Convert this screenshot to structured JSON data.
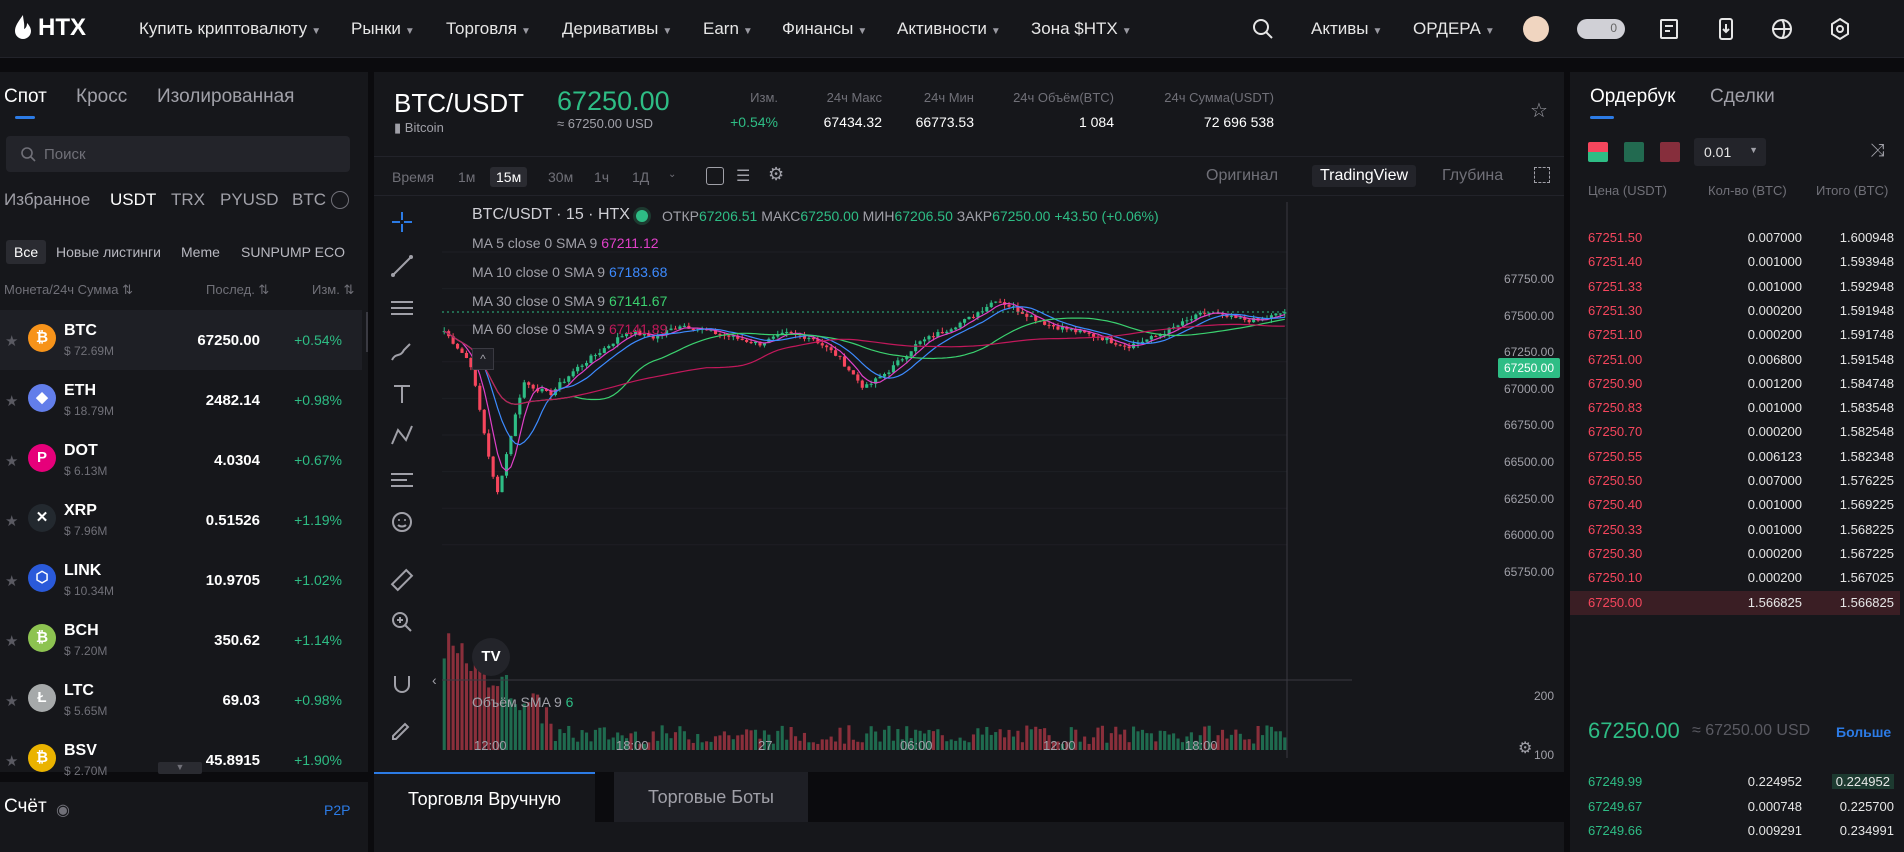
{
  "nav": {
    "logo": "HTX",
    "items": [
      {
        "label": "Купить криптовалюту"
      },
      {
        "label": "Рынки"
      },
      {
        "label": "Торговля"
      },
      {
        "label": "Деривативы"
      },
      {
        "label": "Earn"
      },
      {
        "label": "Финансы"
      },
      {
        "label": "Активности"
      },
      {
        "label": "Зона $HTX"
      }
    ],
    "assets": "Активы",
    "orders": "ОРДЕРА",
    "toggle_value": "0"
  },
  "left": {
    "tabs": [
      "Спот",
      "Кросс",
      "Изолированная"
    ],
    "search_placeholder": "Поиск",
    "quote_tabs": [
      "Избранное",
      "USDT",
      "TRX",
      "PYUSD",
      "BTC"
    ],
    "cat_tabs": [
      "Все",
      "Новые листинги",
      "Meme",
      "SUNPUMP ECO"
    ],
    "col_headers": [
      "Монета/24ч Сумма",
      "Послед.",
      "Изм."
    ],
    "coins": [
      {
        "sym": "BTC",
        "vol": "$ 72.69M",
        "price": "67250.00",
        "chg": "+0.54%",
        "color": "#f7931a",
        "glyph": "₿"
      },
      {
        "sym": "ETH",
        "vol": "$ 18.79M",
        "price": "2482.14",
        "chg": "+0.98%",
        "color": "#627eea",
        "glyph": "◆"
      },
      {
        "sym": "DOT",
        "vol": "$ 6.13M",
        "price": "4.0304",
        "chg": "+0.67%",
        "color": "#e6007a",
        "glyph": "P"
      },
      {
        "sym": "XRP",
        "vol": "$ 7.96M",
        "price": "0.51526",
        "chg": "+1.19%",
        "color": "#23292f",
        "glyph": "✕"
      },
      {
        "sym": "LINK",
        "vol": "$ 10.34M",
        "price": "10.9705",
        "chg": "+1.02%",
        "color": "#2a5ada",
        "glyph": "⬡"
      },
      {
        "sym": "BCH",
        "vol": "$ 7.20M",
        "price": "350.62",
        "chg": "+1.14%",
        "color": "#8dc351",
        "glyph": "₿"
      },
      {
        "sym": "LTC",
        "vol": "$ 5.65M",
        "price": "69.03",
        "chg": "+0.98%",
        "color": "#a6a9aa",
        "glyph": "Ł"
      },
      {
        "sym": "BSV",
        "vol": "$ 2.70M",
        "price": "45.8915",
        "chg": "+1.90%",
        "color": "#eab300",
        "glyph": "₿"
      }
    ],
    "account_title": "Счёт",
    "p2p": "P2P"
  },
  "ticker": {
    "pair": "BTC/USDT",
    "name": "Bitcoin",
    "last": "67250.00",
    "last_usd": "≈ 67250.00 USD",
    "stats": [
      {
        "label": "Изм.",
        "value": "+0.54%"
      },
      {
        "label": "24ч Макс",
        "value": "67434.32"
      },
      {
        "label": "24ч Мин",
        "value": "66773.53"
      },
      {
        "label": "24ч Объём(BTC)",
        "value": "1 084"
      },
      {
        "label": "24ч Сумма(USDT)",
        "value": "72 696 538"
      }
    ]
  },
  "toolbar": {
    "timeframes": [
      "Время",
      "1м",
      "15м",
      "30м",
      "1ч",
      "1Д"
    ],
    "views": [
      "Оригинал",
      "TradingView",
      "Глубина"
    ]
  },
  "chart": {
    "legend_title": "BTC/USDT · 15 · HTX",
    "ohlc": {
      "o_label": "ОТКР",
      "o": "67206.51",
      "h_label": "МАКС",
      "h": "67250.00",
      "l_label": "МИН",
      "l": "67206.50",
      "c_label": "ЗАКР",
      "c": "67250.00",
      "chg": "+43.50 (+0.06%)"
    },
    "ma": [
      {
        "label": "MA 5 close 0 SMA 9",
        "value": "67211.12",
        "color": "#e040c8"
      },
      {
        "label": "MA 10 close 0 SMA 9",
        "value": "67183.68",
        "color": "#3d8bff"
      },
      {
        "label": "MA 30 close 0 SMA 9",
        "value": "67141.67",
        "color": "#3bd16f"
      },
      {
        "label": "MA 60 close 0 SMA 9",
        "value": "67141.89",
        "color": "#c2185b"
      }
    ],
    "y_ticks": [
      "67750.00",
      "67500.00",
      "67250.00",
      "67000.00",
      "66750.00",
      "66500.00",
      "66250.00",
      "66000.00",
      "65750.00"
    ],
    "current_price": "67250.00",
    "volume_label": "Объём SMA 9",
    "volume_value": "6",
    "vol_ticks": [
      "200",
      "100"
    ],
    "vol_current": "6",
    "x_ticks": [
      "12:00",
      "18:00",
      "27",
      "06:00",
      "12:00",
      "18:00"
    ]
  },
  "chart_data": {
    "type": "candlestick",
    "title": "BTC/USDT · 15 · HTX",
    "y_range": [
      65600,
      67800
    ],
    "x_ticks": [
      "12:00",
      "18:00",
      "27",
      "06:00",
      "12:00",
      "18:00"
    ],
    "approx_close_path": [
      67100,
      66850,
      65800,
      66700,
      66600,
      66800,
      66950,
      67100,
      67050,
      67150,
      67100,
      67050,
      67000,
      67080,
      67050,
      66900,
      66650,
      66800,
      67000,
      67100,
      67200,
      67350,
      67250,
      67150,
      67100,
      67050,
      66980,
      67050,
      67150,
      67250,
      67200,
      67180,
      67250
    ]
  },
  "trade_tabs": [
    "Торговля Вручную",
    "Торговые Боты"
  ],
  "orderbook": {
    "tabs": [
      "Ордербук",
      "Сделки"
    ],
    "precision": "0.01",
    "headers": [
      "Цена (USDT)",
      "Кол-во (BTC)",
      "Итого (BTC)"
    ],
    "asks": [
      {
        "p": "67251.50",
        "q": "0.007000",
        "t": "1.600948"
      },
      {
        "p": "67251.40",
        "q": "0.001000",
        "t": "1.593948"
      },
      {
        "p": "67251.33",
        "q": "0.001000",
        "t": "1.592948"
      },
      {
        "p": "67251.30",
        "q": "0.000200",
        "t": "1.591948"
      },
      {
        "p": "67251.10",
        "q": "0.000200",
        "t": "1.591748"
      },
      {
        "p": "67251.00",
        "q": "0.006800",
        "t": "1.591548"
      },
      {
        "p": "67250.90",
        "q": "0.001200",
        "t": "1.584748"
      },
      {
        "p": "67250.83",
        "q": "0.001000",
        "t": "1.583548"
      },
      {
        "p": "67250.70",
        "q": "0.000200",
        "t": "1.582548"
      },
      {
        "p": "67250.55",
        "q": "0.006123",
        "t": "1.582348"
      },
      {
        "p": "67250.50",
        "q": "0.007000",
        "t": "1.576225"
      },
      {
        "p": "67250.40",
        "q": "0.001000",
        "t": "1.569225"
      },
      {
        "p": "67250.33",
        "q": "0.001000",
        "t": "1.568225"
      },
      {
        "p": "67250.30",
        "q": "0.000200",
        "t": "1.567225"
      },
      {
        "p": "67250.10",
        "q": "0.000200",
        "t": "1.567025"
      },
      {
        "p": "67250.00",
        "q": "1.566825",
        "t": "1.566825"
      }
    ],
    "mid_price": "67250.00",
    "mid_usd": "≈ 67250.00 USD",
    "more": "Больше",
    "bids": [
      {
        "p": "67249.99",
        "q": "0.224952",
        "t": "0.224952"
      },
      {
        "p": "67249.67",
        "q": "0.000748",
        "t": "0.225700"
      },
      {
        "p": "67249.66",
        "q": "0.009291",
        "t": "0.234991"
      }
    ]
  }
}
